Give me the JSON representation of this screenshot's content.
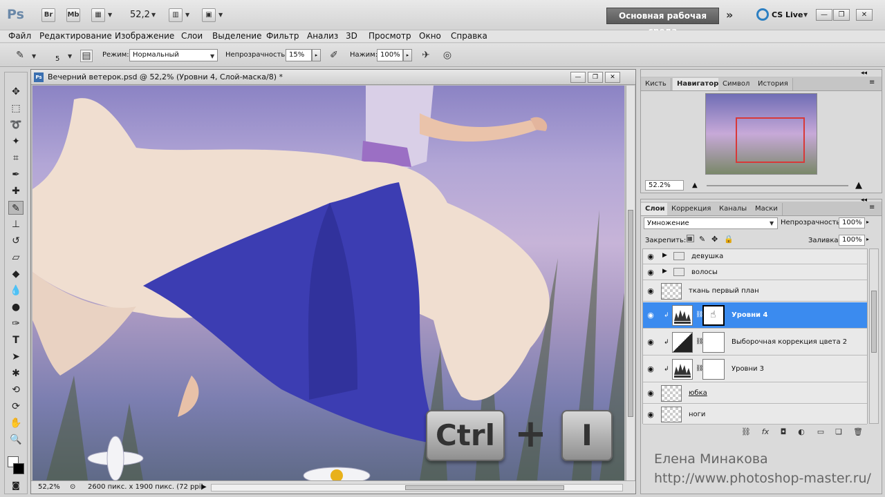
{
  "app": {
    "logo": "Ps",
    "bridge": "Br",
    "minibridge": "Mb",
    "zoom": "52,2",
    "workspace": "Основная рабочая среда",
    "cs_live": "CS Live"
  },
  "menu": [
    "Файл",
    "Редактирование",
    "Изображение",
    "Слои",
    "Выделение",
    "Фильтр",
    "Анализ",
    "3D",
    "Просмотр",
    "Окно",
    "Справка"
  ],
  "options": {
    "brush_size": "5",
    "mode_label": "Режим:",
    "mode_value": "Нормальный",
    "opacity_label": "Непрозрачность:",
    "opacity_value": "15%",
    "flow_label": "Нажим:",
    "flow_value": "100%"
  },
  "document": {
    "title": "Вечерний ветерок.psd @ 52,2% (Уровни 4, Слой-маска/8) *",
    "status_zoom": "52,2%",
    "status_info": "2600 пикс. x 1900 пикс. (72 ppi)"
  },
  "navigator": {
    "tabs": [
      "Кисть",
      "Навигатор",
      "Символ",
      "История"
    ],
    "active_tab": "Навигатор",
    "zoom": "52.2%"
  },
  "layers_panel": {
    "tabs": [
      "Слои",
      "Коррекция",
      "Каналы",
      "Маски"
    ],
    "blend_mode": "Умножение",
    "opacity_label": "Непрозрачность:",
    "opacity_value": "100%",
    "lock_label": "Закрепить:",
    "fill_label": "Заливка:",
    "fill_value": "100%",
    "layers": [
      {
        "name": "девушка",
        "type": "group"
      },
      {
        "name": "волосы",
        "type": "group"
      },
      {
        "name": "ткань первый план",
        "type": "pixel"
      },
      {
        "name": "Уровни 4",
        "type": "adjustment",
        "selected": true
      },
      {
        "name": "Выборочная коррекция цвета 2",
        "type": "adjustment"
      },
      {
        "name": "Уровни 3",
        "type": "adjustment"
      },
      {
        "name": "юбка",
        "type": "pixel"
      },
      {
        "name": "ноги",
        "type": "pixel"
      }
    ]
  },
  "overlay": {
    "key1": "Ctrl",
    "plus": "+",
    "key2": "I",
    "author": "Елена Минакова",
    "site": "http://www.photoshop-master.ru/"
  }
}
